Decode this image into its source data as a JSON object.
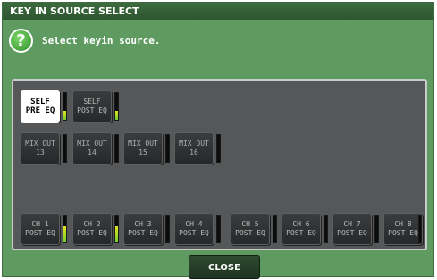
{
  "window": {
    "title": "KEY IN SOURCE SELECT",
    "instruction": "Select keyin source."
  },
  "help_icon": {
    "glyph": "?",
    "icon": "help-icon"
  },
  "sources": {
    "self": [
      {
        "line1": "SELF",
        "line2": "PRE EQ",
        "selected": true,
        "meter_level": 0.35
      },
      {
        "line1": "SELF",
        "line2": "POST EQ",
        "selected": false,
        "meter_level": 0.35
      }
    ],
    "mix_out": [
      {
        "line1": "MIX OUT",
        "line2": "13",
        "meter_level": 0
      },
      {
        "line1": "MIX OUT",
        "line2": "14",
        "meter_level": 0
      },
      {
        "line1": "MIX OUT",
        "line2": "15",
        "meter_level": 0
      },
      {
        "line1": "MIX OUT",
        "line2": "16",
        "meter_level": 0
      }
    ],
    "channels": [
      {
        "line1": "CH 1",
        "line2": "POST EQ",
        "meter_level": 0.6
      },
      {
        "line1": "CH 2",
        "line2": "POST EQ",
        "meter_level": 0.6
      },
      {
        "line1": "CH 3",
        "line2": "POST EQ",
        "meter_level": 0
      },
      {
        "line1": "CH 4",
        "line2": "POST EQ",
        "meter_level": 0
      },
      {
        "line1": "CH 5",
        "line2": "POST EQ",
        "meter_level": 0
      },
      {
        "line1": "CH 6",
        "line2": "POST EQ",
        "meter_level": 0
      },
      {
        "line1": "CH 7",
        "line2": "POST EQ",
        "meter_level": 0
      },
      {
        "line1": "CH 8",
        "line2": "POST EQ",
        "meter_level": 0
      }
    ]
  },
  "close_button": {
    "label": "CLOSE"
  },
  "colors": {
    "window_bg": "#5f9b60",
    "titlebar": "#2e5530",
    "panel_bg": "#555759",
    "selected_button": "#ffffff",
    "meter_fill": "#e6e51e"
  }
}
